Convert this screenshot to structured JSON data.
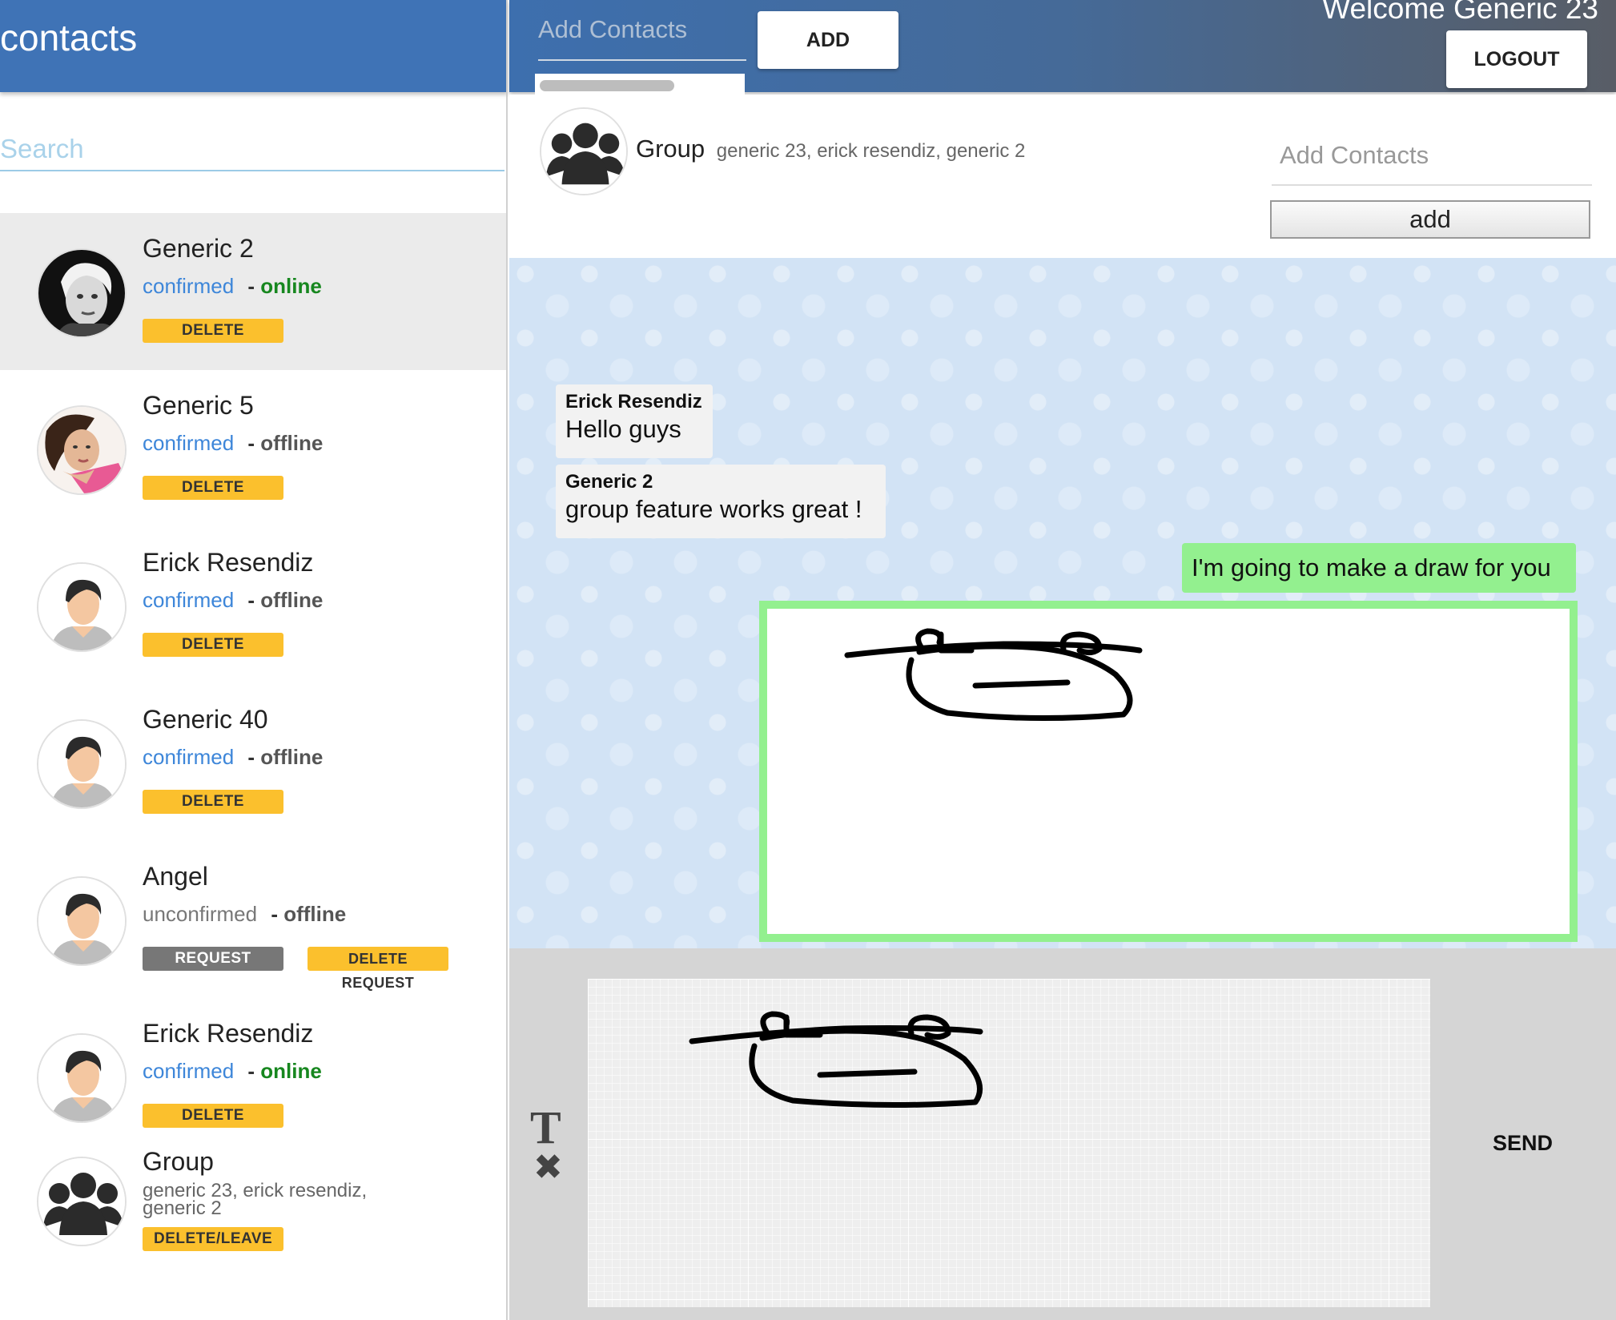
{
  "sidebar": {
    "title": "contacts",
    "search_placeholder": "Search",
    "contacts": [
      {
        "name": "Generic 2",
        "confirm": "confirmed",
        "status": "online",
        "button": "DELETE"
      },
      {
        "name": "Generic 5",
        "confirm": "confirmed",
        "status": "offline",
        "button": "DELETE"
      },
      {
        "name": "Erick Resendiz",
        "confirm": "confirmed",
        "status": "offline",
        "button": "DELETE"
      },
      {
        "name": "Generic 40",
        "confirm": "confirmed",
        "status": "offline",
        "button": "DELETE"
      },
      {
        "name": "Angel",
        "confirm": "unconfirmed",
        "status": "offline",
        "button": "REQUEST SENT",
        "button2": "DELETE REQUEST"
      },
      {
        "name": "Erick Resendiz",
        "confirm": "confirmed",
        "status": "online",
        "button": "DELETE"
      },
      {
        "name": "Group",
        "members": "generic 23, erick resendiz, generic 2",
        "button": "DELETE/LEAVE"
      }
    ],
    "dash": "-"
  },
  "topbar": {
    "add_placeholder": "Add Contacts",
    "add_label": "ADD",
    "welcome": "Welcome Generic 23",
    "logout_label": "LOGOUT"
  },
  "chat": {
    "title": "Group",
    "members": "generic 23, erick resendiz, generic 2",
    "add_placeholder": "Add Contacts",
    "add_label": "add",
    "messages": [
      {
        "sender": "Erick Resendiz",
        "text": "Hello guys"
      },
      {
        "sender": "Generic 2",
        "text": "group feature works great !"
      }
    ],
    "own_message": "I'm going to make a draw for you"
  },
  "composer": {
    "text_tool": "T",
    "clear_tool": "✖",
    "send_label": "SEND"
  },
  "icons": {
    "group": "group-icon",
    "default_avatar": "default-user-icon",
    "photo_avatar": "user-photo-icon"
  },
  "colors": {
    "header_blue": "#3f73b6",
    "confirmed": "#3d86d9",
    "online": "#17871f",
    "delete_button": "#fbc02d",
    "own_bubble": "#93f08f",
    "chat_bg": "#d2e3f5"
  }
}
